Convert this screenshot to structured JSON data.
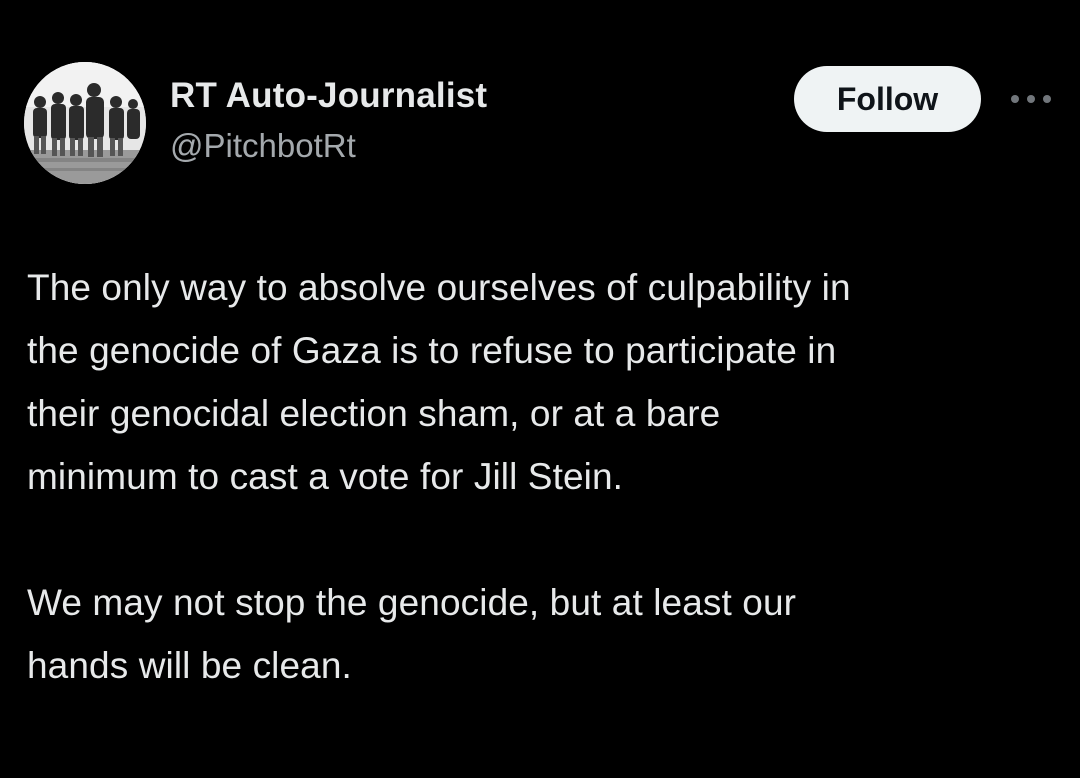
{
  "post": {
    "author": {
      "display_name": "RT Auto-Journalist",
      "handle": "@PitchbotRt",
      "avatar_icon": "soldiers-photo-avatar"
    },
    "follow_label": "Follow",
    "more_icon": "ellipsis-horizontal-icon",
    "body_lines": [
      "The only way to absolve ourselves of culpability in",
      "the genocide of Gaza is to refuse to participate in",
      "their genocidal election sham, or at a bare",
      "minimum to cast a vote for Jill Stein.",
      "We may not stop the genocide, but at least our",
      "hands will be clean."
    ]
  },
  "colors": {
    "background": "#000000",
    "text_primary": "#e7e9ea",
    "text_secondary": "#a4a9ad",
    "follow_bg": "#eff3f4",
    "follow_text": "#0f1419"
  }
}
